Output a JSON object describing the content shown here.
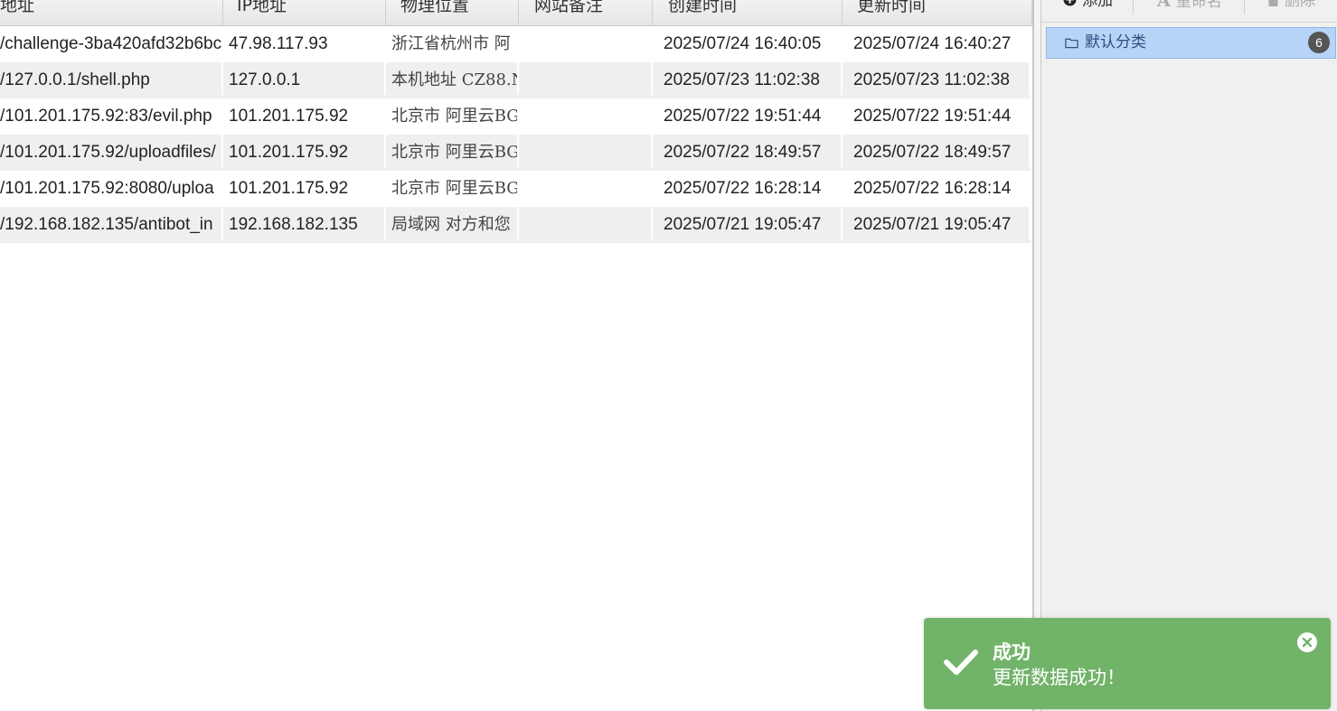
{
  "grid": {
    "columns": [
      {
        "key": "url",
        "label": "地址"
      },
      {
        "key": "ip",
        "label": "IP地址"
      },
      {
        "key": "location",
        "label": "物理位置"
      },
      {
        "key": "note",
        "label": "网站备注"
      },
      {
        "key": "created",
        "label": "创建时间"
      },
      {
        "key": "updated",
        "label": "更新时间"
      }
    ],
    "rows": [
      {
        "url": "/challenge-3ba420afd32b6bc",
        "ip": "47.98.117.93",
        "location": "浙江省杭州市 阿",
        "note": "",
        "created": "2025/07/24 16:40:05",
        "updated": "2025/07/24 16:40:27"
      },
      {
        "url": "/127.0.0.1/shell.php",
        "ip": "127.0.0.1",
        "location": "本机地址 CZ88.N",
        "note": "",
        "created": "2025/07/23 11:02:38",
        "updated": "2025/07/23 11:02:38"
      },
      {
        "url": "/101.201.175.92:83/evil.php",
        "ip": "101.201.175.92",
        "location": "北京市 阿里云BG",
        "note": "",
        "created": "2025/07/22 19:51:44",
        "updated": "2025/07/22 19:51:44"
      },
      {
        "url": "/101.201.175.92/uploadfiles/",
        "ip": "101.201.175.92",
        "location": "北京市 阿里云BG",
        "note": "",
        "created": "2025/07/22 18:49:57",
        "updated": "2025/07/22 18:49:57"
      },
      {
        "url": "/101.201.175.92:8080/uploa",
        "ip": "101.201.175.92",
        "location": "北京市 阿里云BG",
        "note": "",
        "created": "2025/07/22 16:28:14",
        "updated": "2025/07/22 16:28:14"
      },
      {
        "url": "/192.168.182.135/antibot_in",
        "ip": "192.168.182.135",
        "location": "局域网 对方和您",
        "note": "",
        "created": "2025/07/21 19:05:47",
        "updated": "2025/07/21 19:05:47"
      }
    ]
  },
  "sidebar": {
    "toolbar": {
      "add_label": "添加",
      "rename_label": "重命名",
      "delete_label": "删除"
    },
    "categories": [
      {
        "label": "默认分类",
        "count": "6"
      }
    ]
  },
  "toast": {
    "title": "成功",
    "message": "更新数据成功！"
  },
  "colors": {
    "selected_category": "#b7d4f7",
    "toast_success": "#72b36a",
    "alt_row": "#efefef"
  }
}
